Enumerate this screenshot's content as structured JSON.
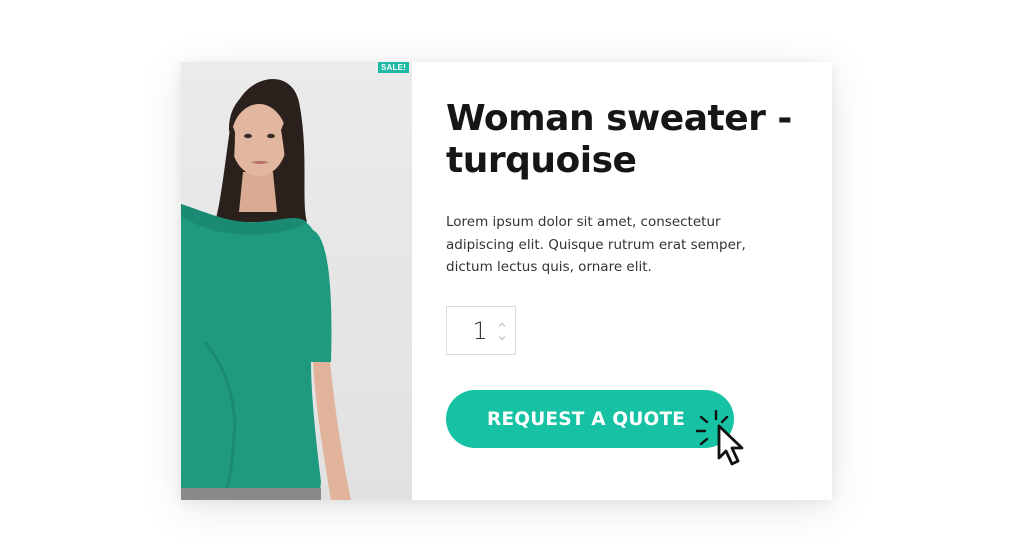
{
  "product": {
    "badge": "SALE!",
    "title": "Woman sweater - turquoise",
    "description": "Lorem ipsum dolor sit amet, consectetur adipiscing elit. Quisque rutrum erat semper, dictum lectus quis, ornare elit.",
    "quantity": "1",
    "request_button_label": "REQUEST A QUOTE",
    "image_icon": "model-wearing-turquoise-top"
  },
  "icons": {
    "quantity_up": "chevron-up-icon",
    "quantity_down": "chevron-down-icon",
    "cursor": "mouse-pointer-click-icon"
  },
  "colors": {
    "accent": "#16c2a3",
    "badge": "#1fb8a4",
    "title": "#161616",
    "text": "#333333",
    "garment": "#1f9a80"
  }
}
